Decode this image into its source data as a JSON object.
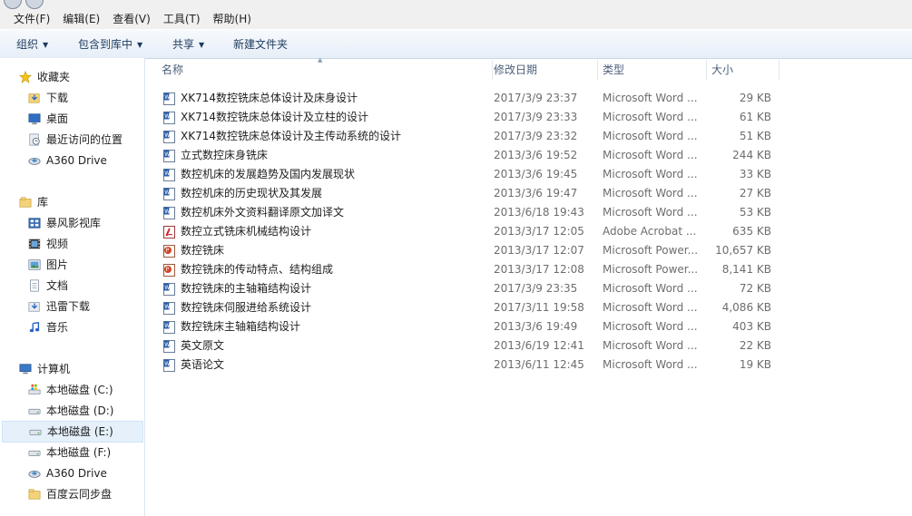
{
  "menu": [
    "文件(F)",
    "编辑(E)",
    "查看(V)",
    "工具(T)",
    "帮助(H)"
  ],
  "toolbar": {
    "organize": "组织",
    "include": "包含到库中",
    "share": "共享",
    "new_folder": "新建文件夹"
  },
  "nav": {
    "favorites": {
      "title": "收藏夹",
      "items": [
        "下载",
        "桌面",
        "最近访问的位置",
        "A360 Drive"
      ]
    },
    "libraries": {
      "title": "库",
      "items": [
        "暴风影视库",
        "视频",
        "图片",
        "文档",
        "迅雷下载",
        "音乐"
      ]
    },
    "computer": {
      "title": "计算机",
      "items": [
        "本地磁盘 (C:)",
        "本地磁盘 (D:)",
        "本地磁盘 (E:)",
        "本地磁盘 (F:)",
        "A360 Drive",
        "百度云同步盘"
      ],
      "selected": "本地磁盘 (E:)"
    }
  },
  "columns": {
    "name": "名称",
    "date": "修改日期",
    "type": "类型",
    "size": "大小"
  },
  "files": [
    {
      "name": "XK714数控铣床总体设计及床身设计",
      "date": "2017/3/9 23:37",
      "type": "Microsoft Word ...",
      "size": "29 KB",
      "icon": "word-doc-icon"
    },
    {
      "name": "XK714数控铣床总体设计及立柱的设计",
      "date": "2017/3/9 23:33",
      "type": "Microsoft Word ...",
      "size": "61 KB",
      "icon": "word-doc-icon"
    },
    {
      "name": "XK714数控铣床总体设计及主传动系统的设计",
      "date": "2017/3/9 23:32",
      "type": "Microsoft Word ...",
      "size": "51 KB",
      "icon": "word-doc-icon"
    },
    {
      "name": "立式数控床身铣床",
      "date": "2013/3/6 19:52",
      "type": "Microsoft Word ...",
      "size": "244 KB",
      "icon": "word-doc-icon"
    },
    {
      "name": "数控机床的发展趋势及国内发展现状",
      "date": "2013/3/6 19:45",
      "type": "Microsoft Word ...",
      "size": "33 KB",
      "icon": "word-doc-icon"
    },
    {
      "name": "数控机床的历史现状及其发展",
      "date": "2013/3/6 19:47",
      "type": "Microsoft Word ...",
      "size": "27 KB",
      "icon": "word-doc-icon"
    },
    {
      "name": "数控机床外文资料翻译原文加译文",
      "date": "2013/6/18 19:43",
      "type": "Microsoft Word ...",
      "size": "53 KB",
      "icon": "word-doc-icon"
    },
    {
      "name": "数控立式铣床机械结构设计",
      "date": "2013/3/17 12:05",
      "type": "Adobe Acrobat ...",
      "size": "635 KB",
      "icon": "pdf-icon"
    },
    {
      "name": "数控铣床",
      "date": "2013/3/17 12:07",
      "type": "Microsoft Power...",
      "size": "10,657 KB",
      "icon": "powerpoint-icon"
    },
    {
      "name": "数控铣床的传动特点、结构组成",
      "date": "2013/3/17 12:08",
      "type": "Microsoft Power...",
      "size": "8,141 KB",
      "icon": "powerpoint-icon"
    },
    {
      "name": "数控铣床的主轴箱结构设计",
      "date": "2017/3/9 23:35",
      "type": "Microsoft Word ...",
      "size": "72 KB",
      "icon": "word-doc-icon"
    },
    {
      "name": "数控铣床伺服进给系统设计",
      "date": "2017/3/11 19:58",
      "type": "Microsoft Word ...",
      "size": "4,086 KB",
      "icon": "word-doc-icon"
    },
    {
      "name": "数控铣床主轴箱结构设计",
      "date": "2013/3/6 19:49",
      "type": "Microsoft Word ...",
      "size": "403 KB",
      "icon": "word-doc-icon"
    },
    {
      "name": "英文原文",
      "date": "2013/6/19 12:41",
      "type": "Microsoft Word ...",
      "size": "22 KB",
      "icon": "word-doc-icon"
    },
    {
      "name": "英语论文",
      "date": "2013/6/11 12:45",
      "type": "Microsoft Word ...",
      "size": "19 KB",
      "icon": "word-doc-icon"
    }
  ],
  "colors": {
    "selection": "#e5f0fb",
    "header_text": "#4c607a",
    "toolbar_text": "#1e3a5f"
  }
}
